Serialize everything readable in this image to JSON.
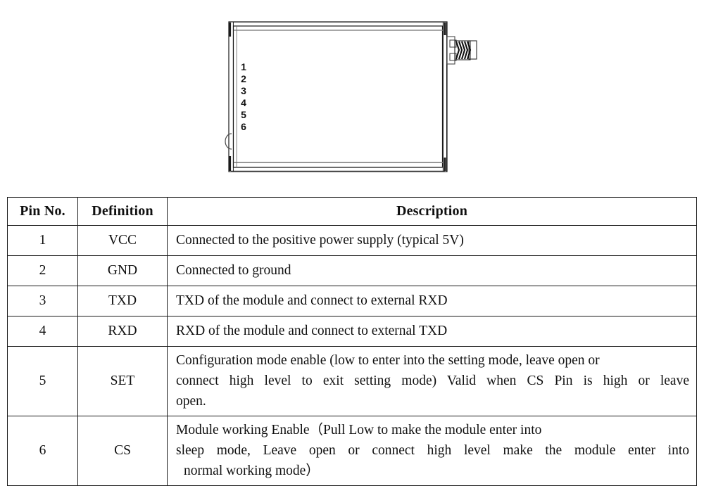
{
  "diagram": {
    "name": "module-top-view-drawing",
    "pin_labels": [
      "1",
      "2",
      "3",
      "4",
      "5",
      "6"
    ],
    "connector_label": "sma-antenna-connector",
    "line_color": "#1a1a1a",
    "accent_color": "#808080"
  },
  "table": {
    "headers": [
      "Pin No.",
      "Definition",
      "Description"
    ],
    "rows": [
      {
        "pin": "1",
        "definition": "VCC",
        "description_lines": [
          "Connected to the positive power supply (typical 5V)"
        ],
        "multiline": false
      },
      {
        "pin": "2",
        "definition": "GND",
        "description_lines": [
          "Connected to ground"
        ],
        "multiline": false
      },
      {
        "pin": "3",
        "definition": "TXD",
        "description_lines": [
          "TXD of the module and connect to external RXD"
        ],
        "multiline": false
      },
      {
        "pin": "4",
        "definition": "RXD",
        "description_lines": [
          "RXD of the module and connect to external TXD"
        ],
        "multiline": false
      },
      {
        "pin": "5",
        "definition": "SET",
        "description_lines": [
          "Configuration mode enable (low to enter into the setting mode, leave open or",
          "connect high level to exit setting mode) Valid when CS Pin is high or leave",
          "open."
        ],
        "multiline": true
      },
      {
        "pin": "6",
        "definition": "CS",
        "description_lines": [
          "Module working Enable（Pull Low to make the module enter into",
          "sleep mode, Leave open or connect high level make the module enter into",
          "normal working mode）"
        ],
        "multiline": true
      }
    ]
  }
}
